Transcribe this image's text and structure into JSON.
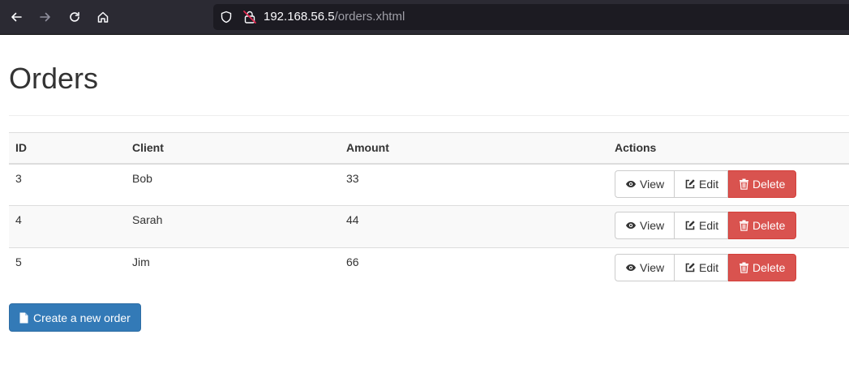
{
  "browser": {
    "url_host": "192.168.56.5",
    "url_path": "/orders.xhtml"
  },
  "page": {
    "title": "Orders"
  },
  "table": {
    "headers": {
      "id": "ID",
      "client": "Client",
      "amount": "Amount",
      "actions": "Actions"
    },
    "rows": [
      {
        "id": "3",
        "client": "Bob",
        "amount": "33"
      },
      {
        "id": "4",
        "client": "Sarah",
        "amount": "44"
      },
      {
        "id": "5",
        "client": "Jim",
        "amount": "66"
      }
    ],
    "actions": {
      "view_label": "View",
      "edit_label": "Edit",
      "delete_label": "Delete"
    }
  },
  "create_button": {
    "label": "Create a new order"
  },
  "icons": {
    "back": "arrow-left-icon",
    "forward": "arrow-right-icon",
    "reload": "reload-icon",
    "home": "home-icon",
    "shield": "shield-icon",
    "lock": "insecure-lock-icon",
    "view": "eye-icon",
    "edit": "edit-icon",
    "delete": "trash-icon",
    "create": "file-icon"
  },
  "colors": {
    "primary": "#337ab7",
    "danger": "#d9534f",
    "toolbar": "#2b2a33"
  }
}
